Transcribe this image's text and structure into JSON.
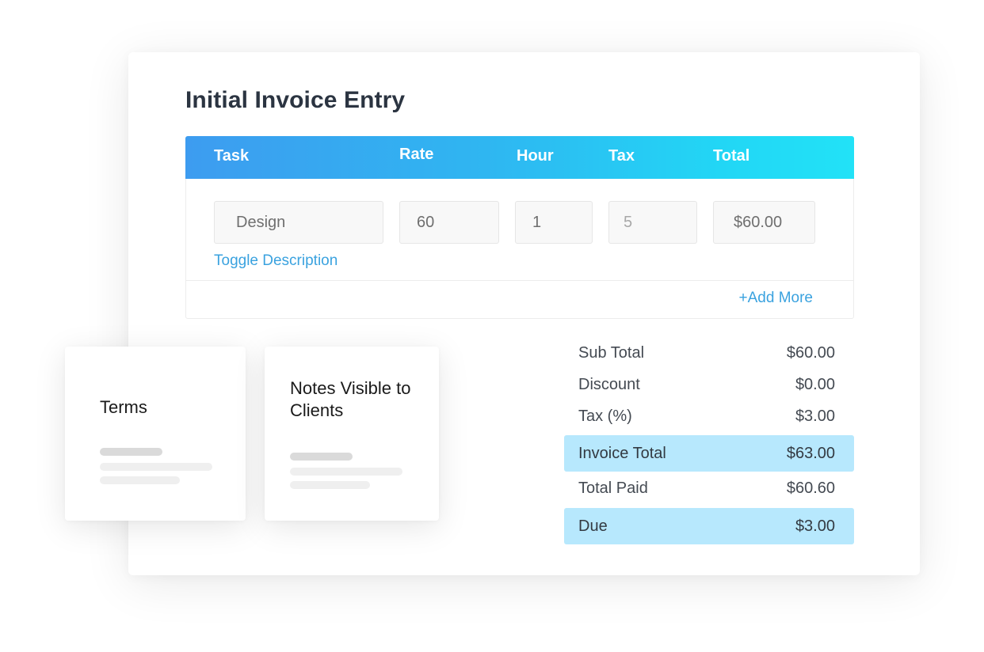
{
  "invoice": {
    "title": "Initial Invoice Entry",
    "columns": [
      "Task",
      "Rate",
      "Hour",
      "Tax",
      "Total"
    ],
    "line_items": [
      {
        "task": "Design",
        "rate": "60",
        "hour": "1",
        "tax_placeholder": "5",
        "total": "$60.00"
      }
    ],
    "toggle_description_label": "Toggle Description",
    "add_more_label": "+Add More",
    "header_gradient": [
      "#3d9cf0",
      "#22e2f7"
    ],
    "link_color": "#3aa2df"
  },
  "summary": {
    "rows": [
      {
        "label": "Sub Total",
        "value": "$60.00",
        "highlight": false
      },
      {
        "label": "Discount",
        "value": "$0.00",
        "highlight": false
      },
      {
        "label": "Tax (%)",
        "value": "$3.00",
        "highlight": false
      },
      {
        "label": "Invoice Total",
        "value": "$63.00",
        "highlight": true
      },
      {
        "label": "Total Paid",
        "value": "$60.60",
        "highlight": false
      },
      {
        "label": "Due",
        "value": "$3.00",
        "highlight": true
      }
    ],
    "highlight_color": "#b7e8fd"
  },
  "cards": {
    "terms": {
      "title": "Terms"
    },
    "notes": {
      "title": "Notes Visible to Clients"
    }
  }
}
